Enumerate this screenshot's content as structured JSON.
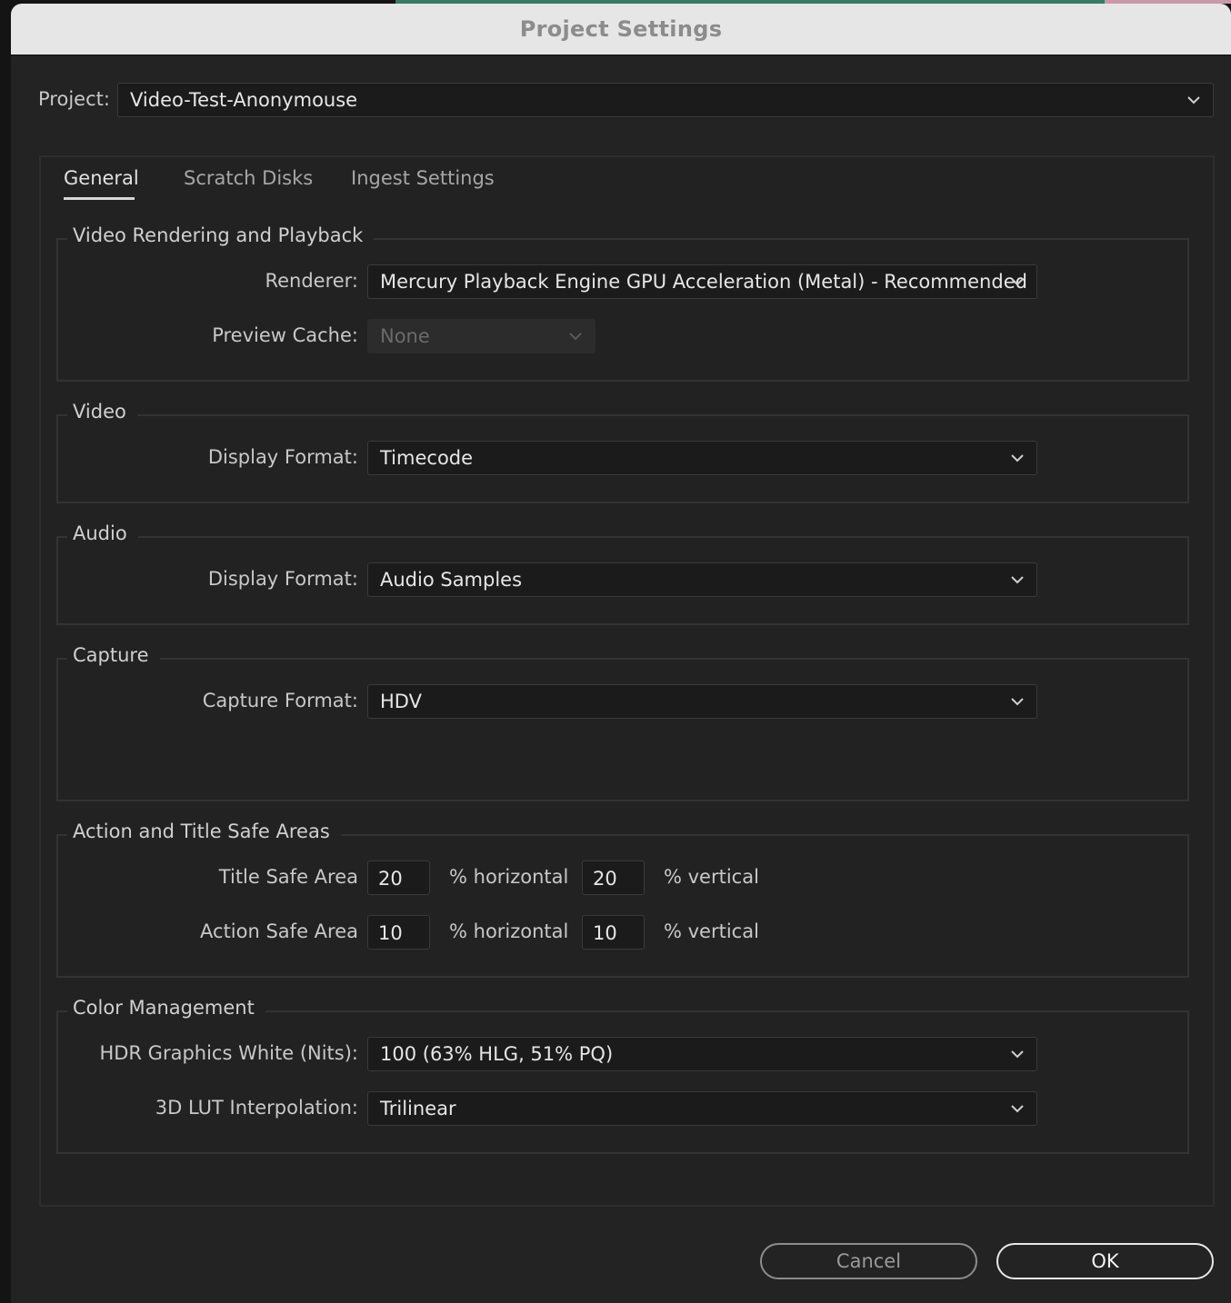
{
  "dialog": {
    "title": "Project Settings"
  },
  "project": {
    "label": "Project:",
    "value": "Video-Test-Anonymouse"
  },
  "tabs": [
    {
      "label": "General",
      "active": true
    },
    {
      "label": "Scratch Disks",
      "active": false
    },
    {
      "label": "Ingest Settings",
      "active": false
    }
  ],
  "video_rendering": {
    "title": "Video Rendering and Playback",
    "renderer_label": "Renderer:",
    "renderer_value": "Mercury Playback Engine GPU Acceleration (Metal) - Recommended",
    "preview_cache_label": "Preview Cache:",
    "preview_cache_value": "None"
  },
  "video": {
    "title": "Video",
    "display_format_label": "Display Format:",
    "display_format_value": "Timecode"
  },
  "audio": {
    "title": "Audio",
    "display_format_label": "Display Format:",
    "display_format_value": "Audio Samples"
  },
  "capture": {
    "title": "Capture",
    "capture_format_label": "Capture Format:",
    "capture_format_value": "HDV"
  },
  "safe_areas": {
    "title": "Action and Title Safe Areas",
    "title_safe_label": "Title Safe Area",
    "title_safe_horizontal": "20",
    "title_safe_vertical": "20",
    "action_safe_label": "Action Safe Area",
    "action_safe_horizontal": "10",
    "action_safe_vertical": "10",
    "horizontal_suffix": "% horizontal",
    "vertical_suffix": "% vertical"
  },
  "color_management": {
    "title": "Color Management",
    "hdr_white_label": "HDR Graphics White (Nits):",
    "hdr_white_value": "100 (63% HLG, 51% PQ)",
    "lut_label": "3D LUT Interpolation:",
    "lut_value": "Trilinear"
  },
  "buttons": {
    "cancel": "Cancel",
    "ok": "OK"
  },
  "icons": {
    "dropdown": "chevron-down-icon"
  },
  "colors": {
    "background": "#232323",
    "titlebar": "#e6e6e6",
    "field": "#1b1b1b"
  }
}
